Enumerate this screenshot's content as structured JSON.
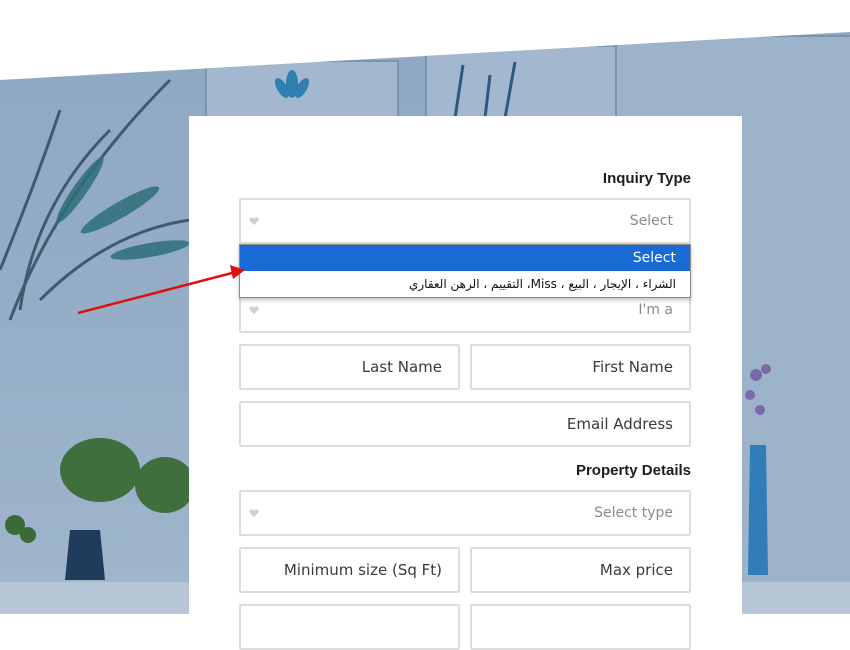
{
  "form": {
    "inquiry_type_label": "Inquiry Type",
    "inquiry_select_value": "Select",
    "iam_placeholder": "I'm a",
    "last_name_placeholder": "Last Name",
    "first_name_placeholder": "First Name",
    "email_placeholder": "Email Address",
    "property_details_label": "Property Details",
    "select_type_placeholder": "Select type",
    "min_size_placeholder": "Minimum size (Sq Ft)",
    "max_price_placeholder": "Max price"
  },
  "dropdown": {
    "options": [
      {
        "label": "Select",
        "selected": true
      },
      {
        "label": "الشراء ، الإيجار ، البيع ، Miss، التقييم ، الرهن العقاري",
        "selected": false
      }
    ]
  },
  "colors": {
    "highlight": "#1a6ad4",
    "annotation_arrow": "#e01010",
    "field_border": "#dcdcdc"
  },
  "icons": {
    "select_caret": "heart-icon"
  }
}
